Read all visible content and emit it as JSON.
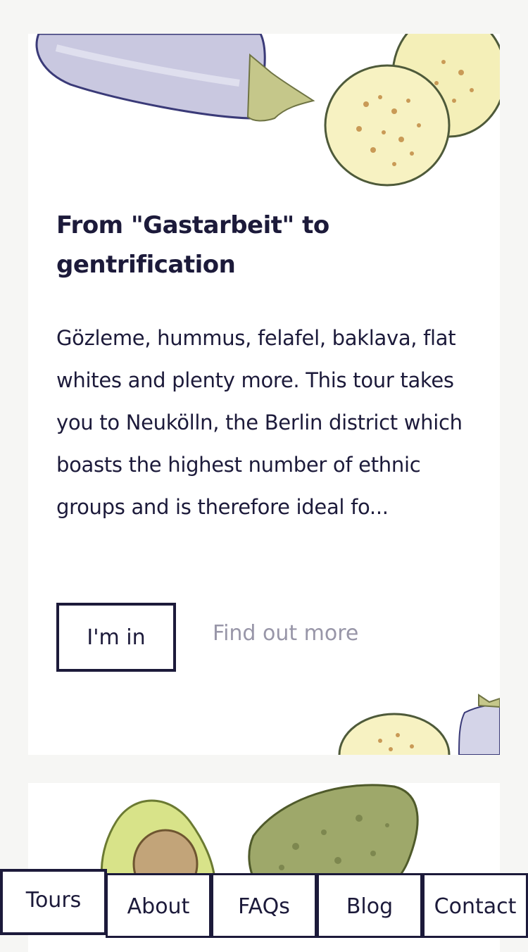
{
  "card": {
    "title": "From \"Gastarbeit\" to gentrification",
    "description": "Gözleme, hummus, felafel, baklava, flat whites and plenty more. This tour takes you to Neukölln, the Berlin district which boasts the highest number of ethnic groups and is therefore ideal fo...",
    "primary_button": "I'm in",
    "secondary_link": "Find out more"
  },
  "nav": {
    "items": [
      {
        "label": "Tours",
        "active": true
      },
      {
        "label": "About",
        "active": false
      },
      {
        "label": "FAQs",
        "active": false
      },
      {
        "label": "Blog",
        "active": false
      },
      {
        "label": "Contact",
        "active": false
      }
    ]
  },
  "colors": {
    "ink": "#1c1a3a",
    "muted_link": "#9896a8",
    "page_bg": "#f6f6f4",
    "card_bg": "#ffffff"
  }
}
